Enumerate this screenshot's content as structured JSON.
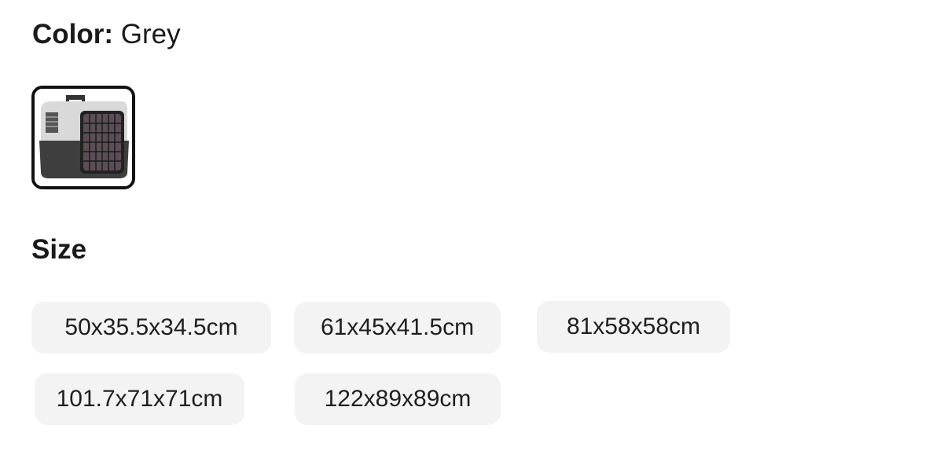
{
  "color": {
    "label": "Color:",
    "value": "Grey"
  },
  "swatches": [
    {
      "name": "Grey",
      "selected": true,
      "image": "grey pet carrier"
    }
  ],
  "size": {
    "title": "Size",
    "options": [
      "50x35.5x34.5cm",
      "61x45x41.5cm",
      "81x58x58cm",
      "101.7x71x71cm",
      "122x89x89cm"
    ]
  }
}
